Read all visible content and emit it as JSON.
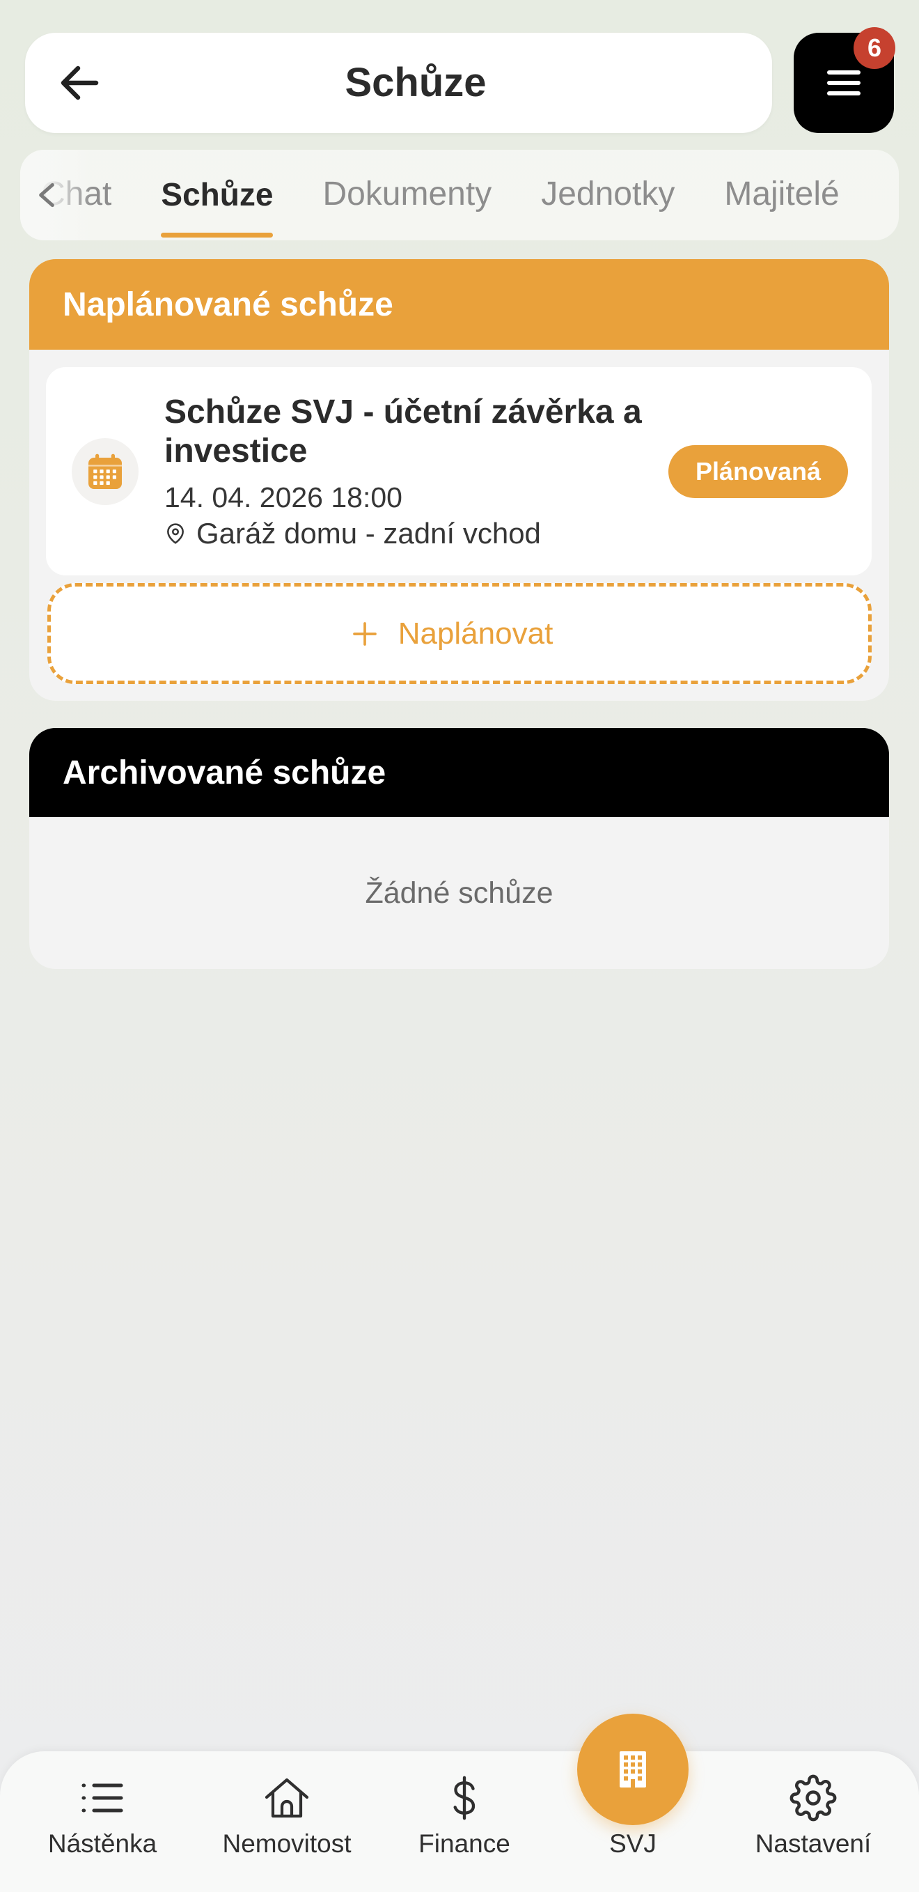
{
  "header": {
    "title": "Schůze",
    "back_icon": "arrow-left-icon",
    "menu_icon": "menu-icon",
    "menu_badge": "6"
  },
  "tabs": {
    "scroll_icon": "chevron-left-icon",
    "items": [
      {
        "label": "Chat",
        "active": false
      },
      {
        "label": "Schůze",
        "active": true
      },
      {
        "label": "Dokumenty",
        "active": false
      },
      {
        "label": "Jednotky",
        "active": false
      },
      {
        "label": "Majitelé",
        "active": false
      }
    ]
  },
  "planned": {
    "title": "Naplánované schůze",
    "meetings": [
      {
        "icon": "calendar-icon",
        "title": "Schůze SVJ - účetní závěrka a investice",
        "datetime": "14. 04. 2026 18:00",
        "location_icon": "map-pin-icon",
        "location": "Garáž domu - zadní vchod",
        "status": "Plánovaná"
      }
    ],
    "add_icon": "plus-icon",
    "add_label": "Naplánovat"
  },
  "archived": {
    "title": "Archivované schůze",
    "empty_text": "Žádné schůze"
  },
  "bottom_nav": {
    "items": [
      {
        "label": "Nástěnka",
        "icon": "list-icon",
        "active": false
      },
      {
        "label": "Nemovitost",
        "icon": "house-icon",
        "active": false
      },
      {
        "label": "Finance",
        "icon": "dollar-icon",
        "active": false
      },
      {
        "label": "SVJ",
        "icon": "building-icon",
        "active": true
      },
      {
        "label": "Nastavení",
        "icon": "gear-icon",
        "active": false
      }
    ]
  },
  "colors": {
    "accent": "#E9A13B",
    "dark": "#000000",
    "badge": "#C6412F",
    "text_primary": "#2B2B2B",
    "text_muted": "#8D8D8D"
  }
}
